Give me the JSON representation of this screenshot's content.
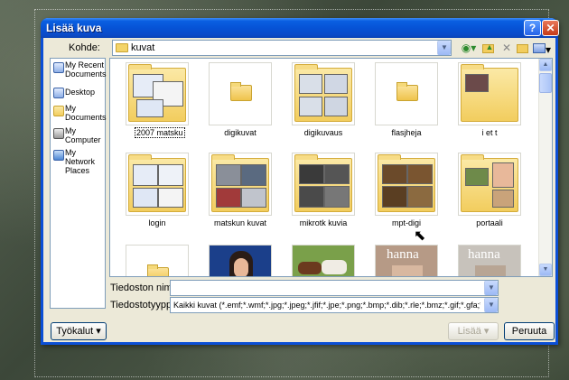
{
  "dialog": {
    "title": "Lisää kuva",
    "help_glyph": "?",
    "close_glyph": "✕"
  },
  "lookin": {
    "label": "Kohde:",
    "value": "kuvat"
  },
  "toolbar": {
    "back_icon": "back-icon",
    "up_icon": "up-folder-icon",
    "delete_icon": "delete-icon",
    "new_folder_icon": "new-folder-icon",
    "views_icon": "views-icon"
  },
  "places": [
    {
      "label": "My Recent Documents",
      "icon": "recent-documents-icon"
    },
    {
      "label": "Desktop",
      "icon": "desktop-icon"
    },
    {
      "label": "My Documents",
      "icon": "my-documents-icon"
    },
    {
      "label": "My Computer",
      "icon": "my-computer-icon"
    },
    {
      "label": "My Network Places",
      "icon": "network-places-icon"
    }
  ],
  "items": [
    {
      "name": "2007 matsku",
      "kind": "folder-preview",
      "selected": true
    },
    {
      "name": "digikuvat",
      "kind": "folder"
    },
    {
      "name": "digikuvaus",
      "kind": "folder-preview"
    },
    {
      "name": "flasjheja",
      "kind": "folder"
    },
    {
      "name": "i et t",
      "kind": "folder-preview"
    },
    {
      "name": "login",
      "kind": "folder-preview"
    },
    {
      "name": "matskun kuvat",
      "kind": "folder-preview"
    },
    {
      "name": "mikrotk kuvia",
      "kind": "folder-preview"
    },
    {
      "name": "mpt-digi",
      "kind": "folder-preview"
    },
    {
      "name": "portaali",
      "kind": "folder-preview"
    },
    {
      "name": "",
      "kind": "folder"
    },
    {
      "name": "",
      "kind": "image"
    },
    {
      "name": "",
      "kind": "image"
    },
    {
      "name": "hanna",
      "kind": "image"
    },
    {
      "name": "hanna",
      "kind": "image"
    }
  ],
  "filename": {
    "label": "Tiedoston nimi:",
    "value": ""
  },
  "filetype": {
    "label": "Tiedostotyyppi:",
    "value": "Kaikki kuvat (*.emf;*.wmf;*.jpg;*.jpeg;*.jfif;*.jpe;*.png;*.bmp;*.dib;*.rle;*.bmz;*.gif;*.gfa;*.e"
  },
  "buttons": {
    "tools": "Työkalut",
    "insert": "Lisää",
    "cancel": "Peruuta"
  },
  "colors": {
    "titlebar": "#0a5fe2",
    "dialog_bg": "#ece9d8",
    "folder": "#f2cd5e"
  }
}
